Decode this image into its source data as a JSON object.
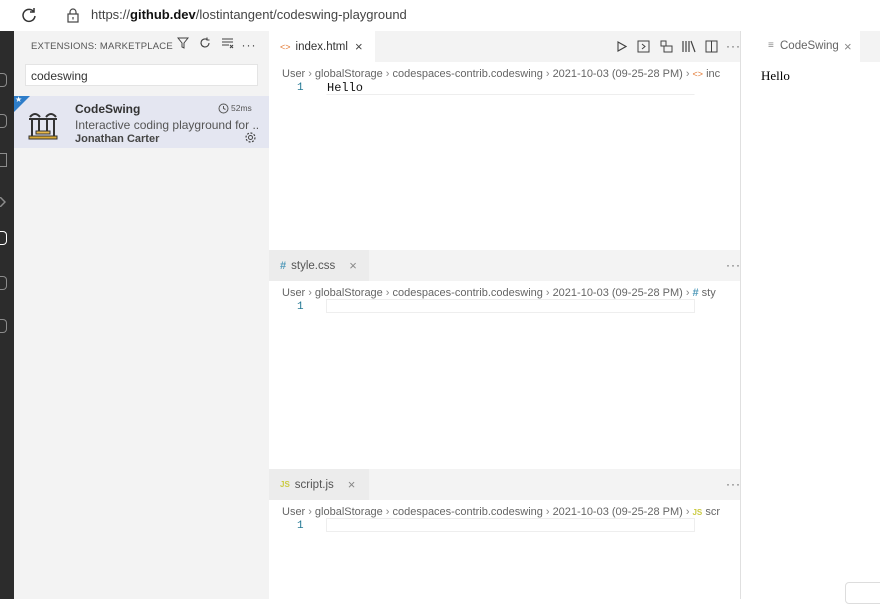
{
  "browser": {
    "url_prefix": "https://",
    "url_domain": "github.dev",
    "url_path": "/lostintangent/codeswing-playground"
  },
  "sidebar": {
    "title": "EXTENSIONS: MARKETPLACE",
    "search_value": "codeswing",
    "extension": {
      "name": "CodeSwing",
      "description": "Interactive coding playground for ...",
      "author": "Jonathan Carter",
      "time": "52ms"
    }
  },
  "editors": {
    "html": {
      "tab_label": "index.html",
      "breadcrumb": [
        "User",
        "globalStorage",
        "codespaces-contrib.codeswing",
        "2021-10-03 (09-25-28 PM)",
        "inc"
      ],
      "lines": [
        {
          "num": "1",
          "text": "Hello"
        }
      ]
    },
    "css": {
      "tab_label": "style.css",
      "breadcrumb": [
        "User",
        "globalStorage",
        "codespaces-contrib.codeswing",
        "2021-10-03 (09-25-28 PM)",
        "sty"
      ],
      "lines": [
        {
          "num": "1",
          "text": ""
        }
      ]
    },
    "js": {
      "tab_label": "script.js",
      "breadcrumb": [
        "User",
        "globalStorage",
        "codespaces-contrib.codeswing",
        "2021-10-03 (09-25-28 PM)",
        "scr"
      ],
      "lines": [
        {
          "num": "1",
          "text": ""
        }
      ]
    }
  },
  "preview": {
    "tab_label": "CodeSwing",
    "content": "Hello"
  },
  "colors": {
    "accent": "#2d7dc9",
    "line_number": "#237893"
  }
}
